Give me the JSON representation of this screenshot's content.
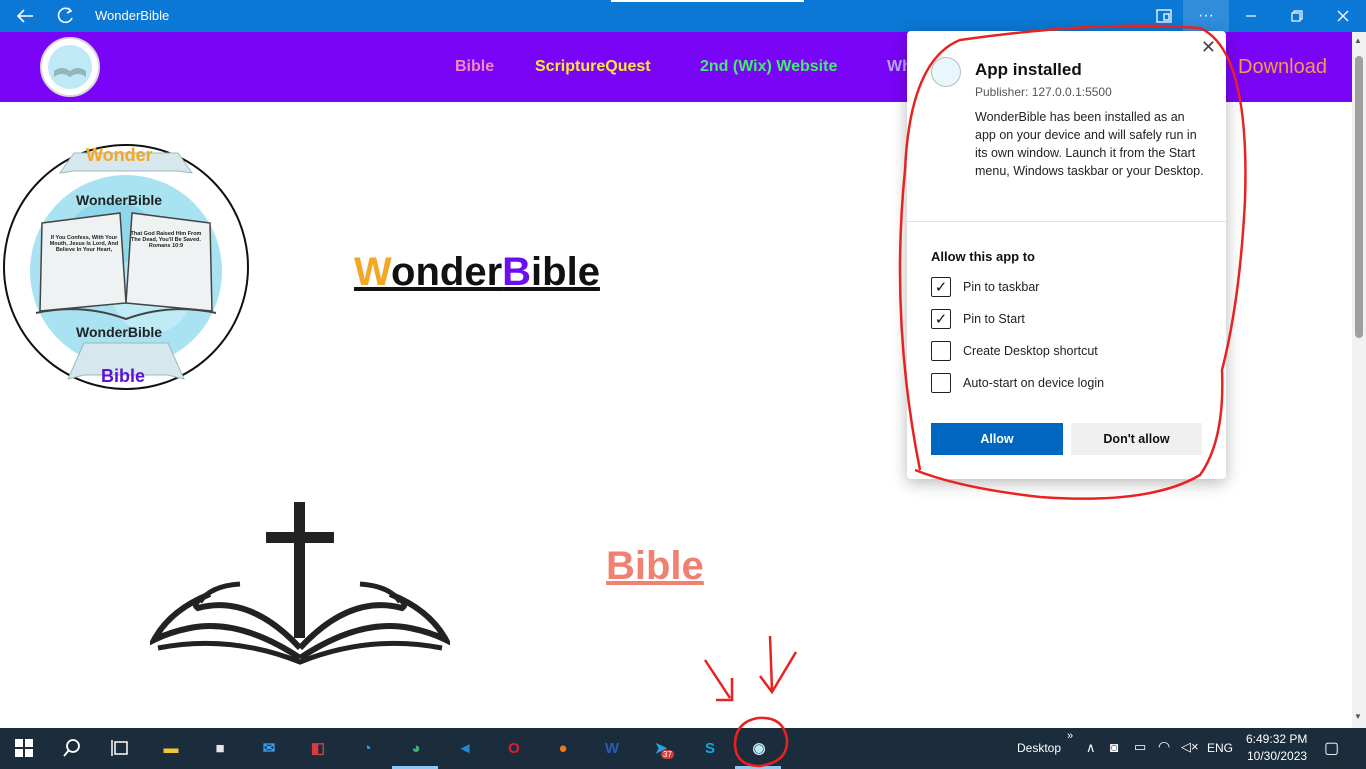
{
  "window": {
    "title": "WonderBible",
    "back_icon": "back-arrow-icon",
    "refresh_icon": "refresh-icon",
    "more_label": "···"
  },
  "nav": {
    "links": [
      {
        "label": "Bible",
        "color": "#f08ab8"
      },
      {
        "label": "ScriptureQuest",
        "color": "#ffe733"
      },
      {
        "label": "2nd (Wix) Website",
        "color": "#3ef06a"
      },
      {
        "label": "Wh",
        "color": "#b9a7ff"
      },
      {
        "label": "Download",
        "color": "#f59a4a"
      }
    ]
  },
  "page": {
    "logo": {
      "top_banner": "Wonder",
      "ring_top": "WonderBible",
      "book_left": "If You Confess, With Your Mouth, Jesus Is Lord, And Believe In Your Heart,",
      "book_right": "That God Raised Him From The Dead, You'll Be Saved. Romans 10:9",
      "ring_bottom": "WonderBible",
      "bottom_banner": "Bible"
    },
    "title_w": "W",
    "title_onder": "onder",
    "title_b": "B",
    "title_ible": "ible",
    "bible_link": "Bible"
  },
  "dialog": {
    "title": "App installed",
    "publisher": "Publisher: 127.0.0.1:5500",
    "description": "WonderBible has been installed as an app on your device and will safely run in its own window. Launch it from the Start menu, Windows taskbar or your Desktop.",
    "allow_heading": "Allow this app to",
    "options": [
      {
        "label": "Pin to taskbar",
        "checked": true,
        "mark": "✓"
      },
      {
        "label": "Pin to Start",
        "checked": true,
        "mark": "✓"
      },
      {
        "label": "Create Desktop shortcut",
        "checked": false,
        "mark": ""
      },
      {
        "label": "Auto-start on device login",
        "checked": false,
        "mark": ""
      }
    ],
    "allow_button": "Allow",
    "deny_button": "Don't allow"
  },
  "taskbar": {
    "apps": [
      {
        "name": "file-explorer-icon",
        "glyph": "▬",
        "color": "#f3c53a"
      },
      {
        "name": "microsoft-store-icon",
        "glyph": "■",
        "color": "#e6e6e6"
      },
      {
        "name": "mail-icon",
        "glyph": "✉",
        "color": "#3a9ff0"
      },
      {
        "name": "pdf-reader-icon",
        "glyph": "◧",
        "color": "#d83b3b"
      },
      {
        "name": "edge-dev-icon",
        "glyph": "◔",
        "color": "#2fa3e0"
      },
      {
        "name": "edge-icon",
        "glyph": "◕",
        "color": "#39b86a"
      },
      {
        "name": "vscode-icon",
        "glyph": "◄",
        "color": "#1f8ad2"
      },
      {
        "name": "opera-icon",
        "glyph": "O",
        "color": "#e0202e"
      },
      {
        "name": "firefox-icon",
        "glyph": "●",
        "color": "#f07a1a"
      },
      {
        "name": "word-icon",
        "glyph": "W",
        "color": "#2b5bb5"
      },
      {
        "name": "telegram-icon",
        "glyph": "➤",
        "color": "#2aa3e0"
      },
      {
        "name": "skype-icon",
        "glyph": "S",
        "color": "#0ea5e9"
      },
      {
        "name": "wonderbible-app-icon",
        "glyph": "◉",
        "color": "#bfe7f5"
      }
    ],
    "telegram_badge": "37",
    "desktop_label": "Desktop",
    "chevrons": "»",
    "lang": "ENG",
    "time": "6:49:32 PM",
    "date": "10/30/2023"
  }
}
